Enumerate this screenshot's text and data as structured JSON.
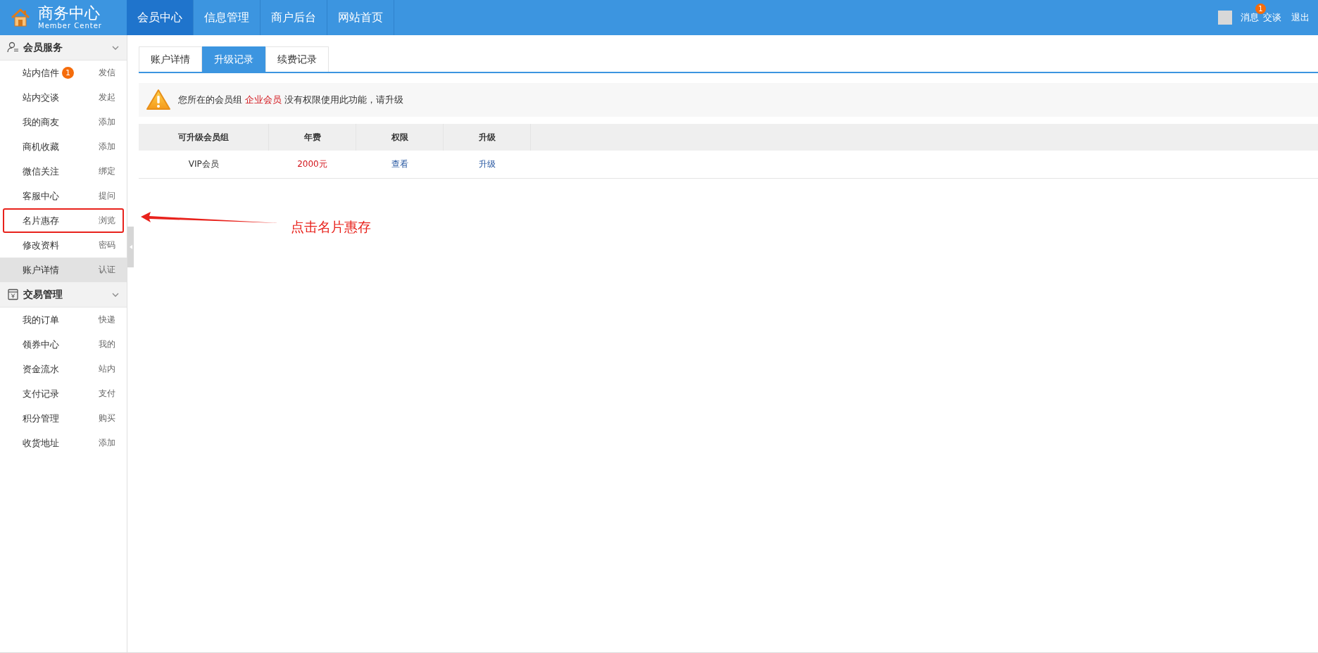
{
  "header": {
    "logo": {
      "title": "商务中心",
      "subtitle": "Member Center"
    },
    "nav": [
      {
        "label": "会员中心",
        "selected": true
      },
      {
        "label": "信息管理",
        "selected": false
      },
      {
        "label": "商户后台",
        "selected": false
      },
      {
        "label": "网站首页",
        "selected": false
      }
    ],
    "user": {
      "messages": "消息",
      "messages_badge": "1",
      "chat": "交谈",
      "logout": "退出"
    }
  },
  "sidebar": {
    "sections": [
      {
        "title": "会员服务",
        "kind": "person",
        "expanded": true,
        "items": [
          {
            "label": "站内信件",
            "badge": "1",
            "action": "发信",
            "selected": false,
            "highlighted": false
          },
          {
            "label": "站内交谈",
            "action": "发起",
            "selected": false,
            "highlighted": false
          },
          {
            "label": "我的商友",
            "action": "添加",
            "selected": false,
            "highlighted": false
          },
          {
            "label": "商机收藏",
            "action": "添加",
            "selected": false,
            "highlighted": false
          },
          {
            "label": "微信关注",
            "action": "绑定",
            "selected": false,
            "highlighted": false
          },
          {
            "label": "客服中心",
            "action": "提问",
            "selected": false,
            "highlighted": false
          },
          {
            "label": "名片惠存",
            "action": "浏览",
            "selected": false,
            "highlighted": true
          },
          {
            "label": "修改资料",
            "action": "密码",
            "selected": false,
            "highlighted": false
          },
          {
            "label": "账户详情",
            "action": "认证",
            "selected": true,
            "highlighted": false
          }
        ]
      },
      {
        "title": "交易管理",
        "kind": "wallet",
        "expanded": true,
        "items": [
          {
            "label": "我的订单",
            "action": "快递",
            "selected": false,
            "highlighted": false
          },
          {
            "label": "领券中心",
            "action": "我的",
            "selected": false,
            "highlighted": false
          },
          {
            "label": "资金流水",
            "action": "站内",
            "selected": false,
            "highlighted": false
          },
          {
            "label": "支付记录",
            "action": "支付",
            "selected": false,
            "highlighted": false
          },
          {
            "label": "积分管理",
            "action": "购买",
            "selected": false,
            "highlighted": false
          },
          {
            "label": "收货地址",
            "action": "添加",
            "selected": false,
            "highlighted": false
          }
        ]
      }
    ]
  },
  "tabs": [
    {
      "label": "账户详情",
      "selected": false
    },
    {
      "label": "升级记录",
      "selected": true
    },
    {
      "label": "续费记录",
      "selected": false
    }
  ],
  "alert": {
    "before": "您所在的会员组",
    "group": "企业会员",
    "after": "没有权限使用此功能，请升级"
  },
  "table": {
    "columns": [
      "可升级会员组",
      "年费",
      "权限",
      "升级"
    ],
    "rows": [
      {
        "group": "VIP会员",
        "fee": "2000元",
        "permission": "查看",
        "upgrade": "升级"
      }
    ]
  },
  "annotation": {
    "label": "点击名片惠存"
  }
}
